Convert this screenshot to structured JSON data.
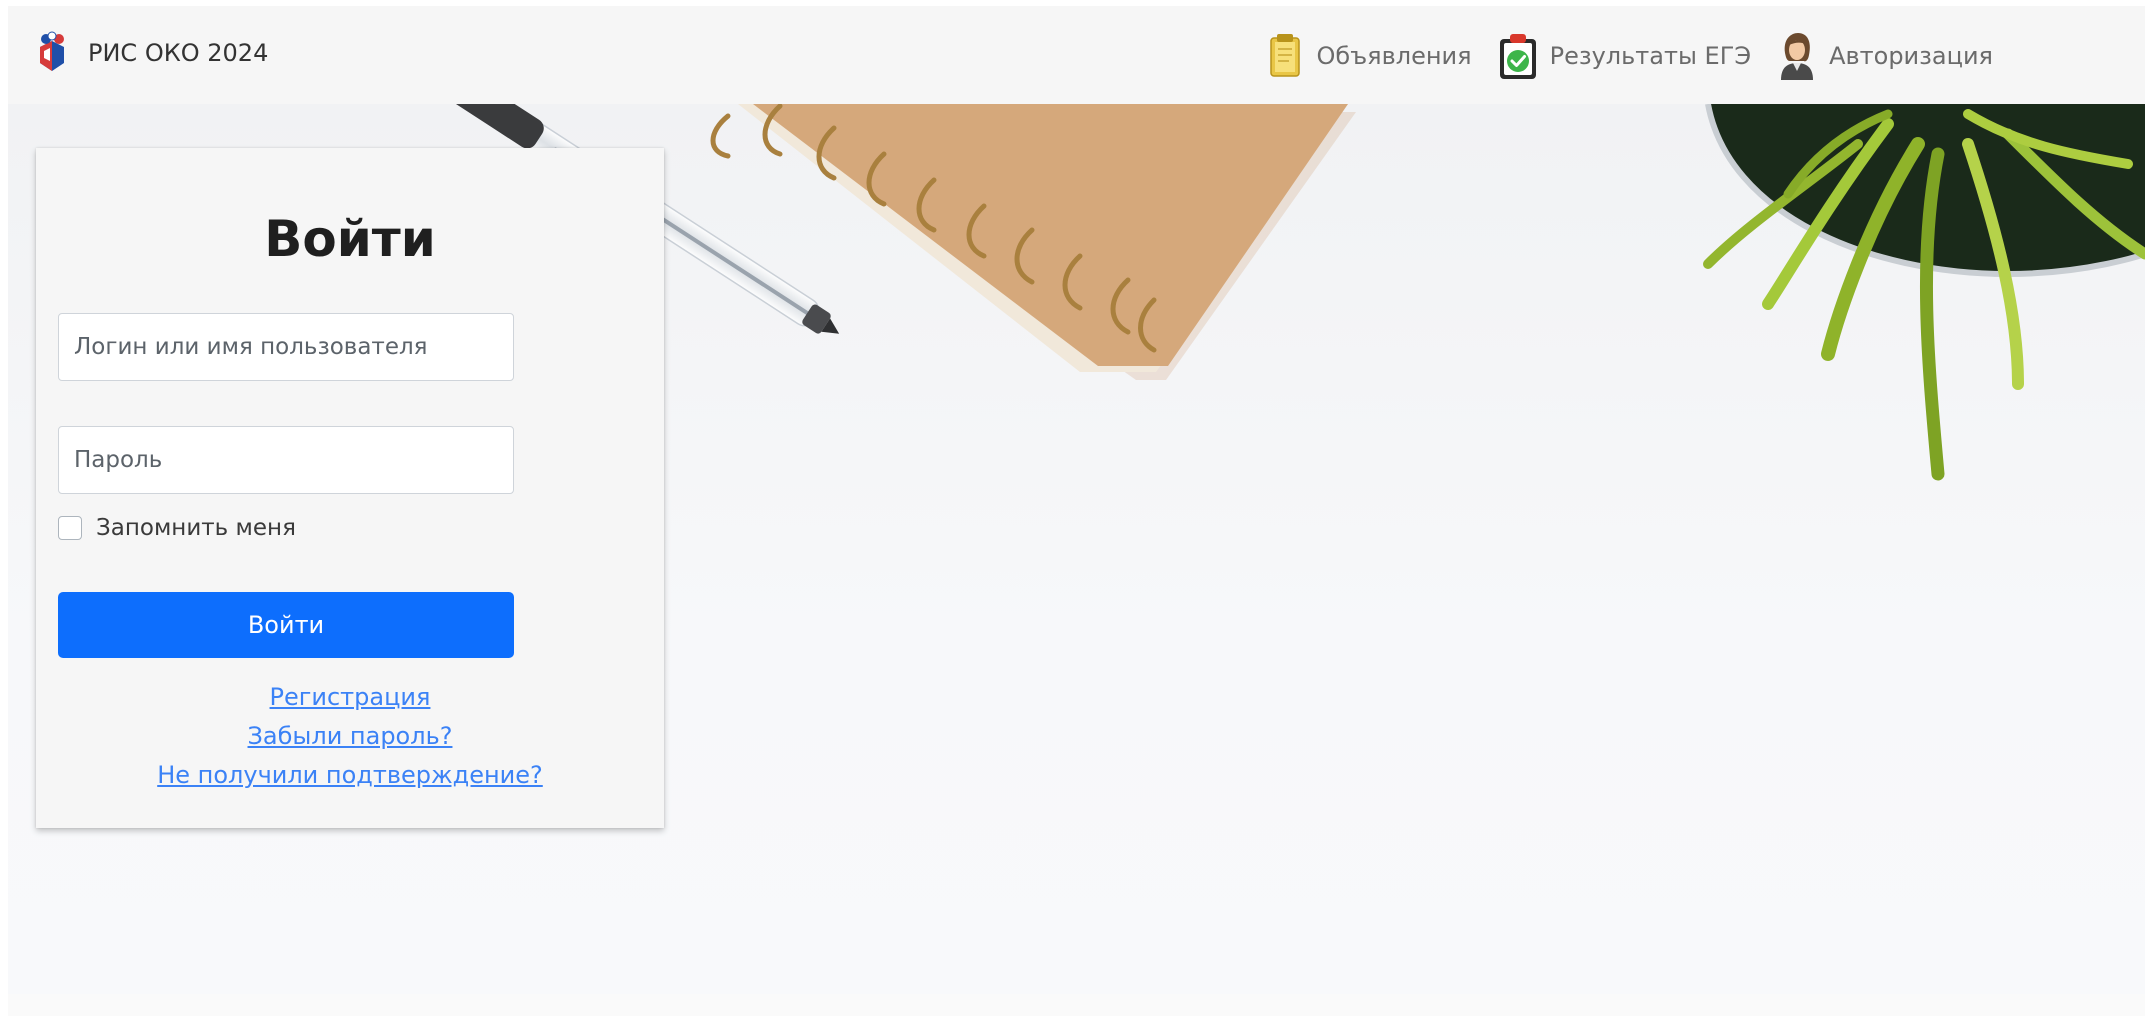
{
  "header": {
    "brand_label": "РИС ОКО 2024",
    "nav": [
      {
        "label": "Объявления",
        "icon": "notepad-icon"
      },
      {
        "label": "Результаты ЕГЭ",
        "icon": "clipboard-check-icon"
      },
      {
        "label": "Авторизация",
        "icon": "user-avatar-icon"
      }
    ]
  },
  "login": {
    "title": "Войти",
    "login_placeholder": "Логин или имя пользователя",
    "password_placeholder": "Пароль",
    "remember_label": "Запомнить меня",
    "remember_checked": false,
    "submit_label": "Войти",
    "links": {
      "register": "Регистрация",
      "forgot": "Забыли пароль?",
      "resend": "Не получили подтверждение?"
    }
  },
  "colors": {
    "primary": "#0d6efd",
    "link": "#3b82f6",
    "header_bg": "#f6f6f6",
    "card_bg": "#f6f6f6"
  }
}
